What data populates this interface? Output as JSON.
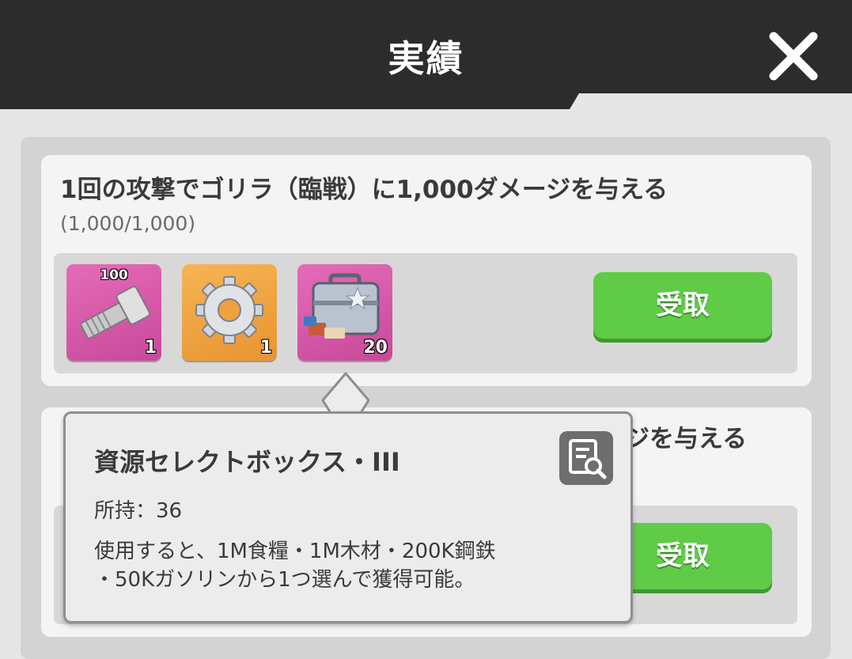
{
  "header": {
    "title": "実績",
    "close_icon": "close-x-icon"
  },
  "achievements": [
    {
      "title": "1回の攻撃でゴリラ（臨戦）に1,000ダメージを与える",
      "progress": "(1,000/1,000)",
      "claim_label": "受取",
      "rewards": [
        {
          "icon": "bolt-icon",
          "badge": "100",
          "qty": "1",
          "color": "#d64fa4"
        },
        {
          "icon": "gear-icon",
          "badge": "",
          "qty": "1",
          "color": "#f0a03c"
        },
        {
          "icon": "toolbox-chest-icon",
          "badge": "",
          "qty": "20",
          "color": "#d64fa4"
        }
      ]
    },
    {
      "title_visible_fragment": "ジを与える",
      "claim_label": "受取"
    }
  ],
  "tooltip": {
    "title": "資源セレクトボックス・III",
    "owned": "所持：36",
    "desc_line1": "使用すると、1M食糧・1M木材・200K鋼鉄",
    "desc_line2": "・50Kガソリンから1つ選んで獲得可能。",
    "detail_icon": "document-search-icon"
  },
  "colors": {
    "header": "#2c2c2c",
    "claim_button": "#5fcb46",
    "rarity_purple": "#d64fa4",
    "rarity_orange": "#f0a03c"
  }
}
